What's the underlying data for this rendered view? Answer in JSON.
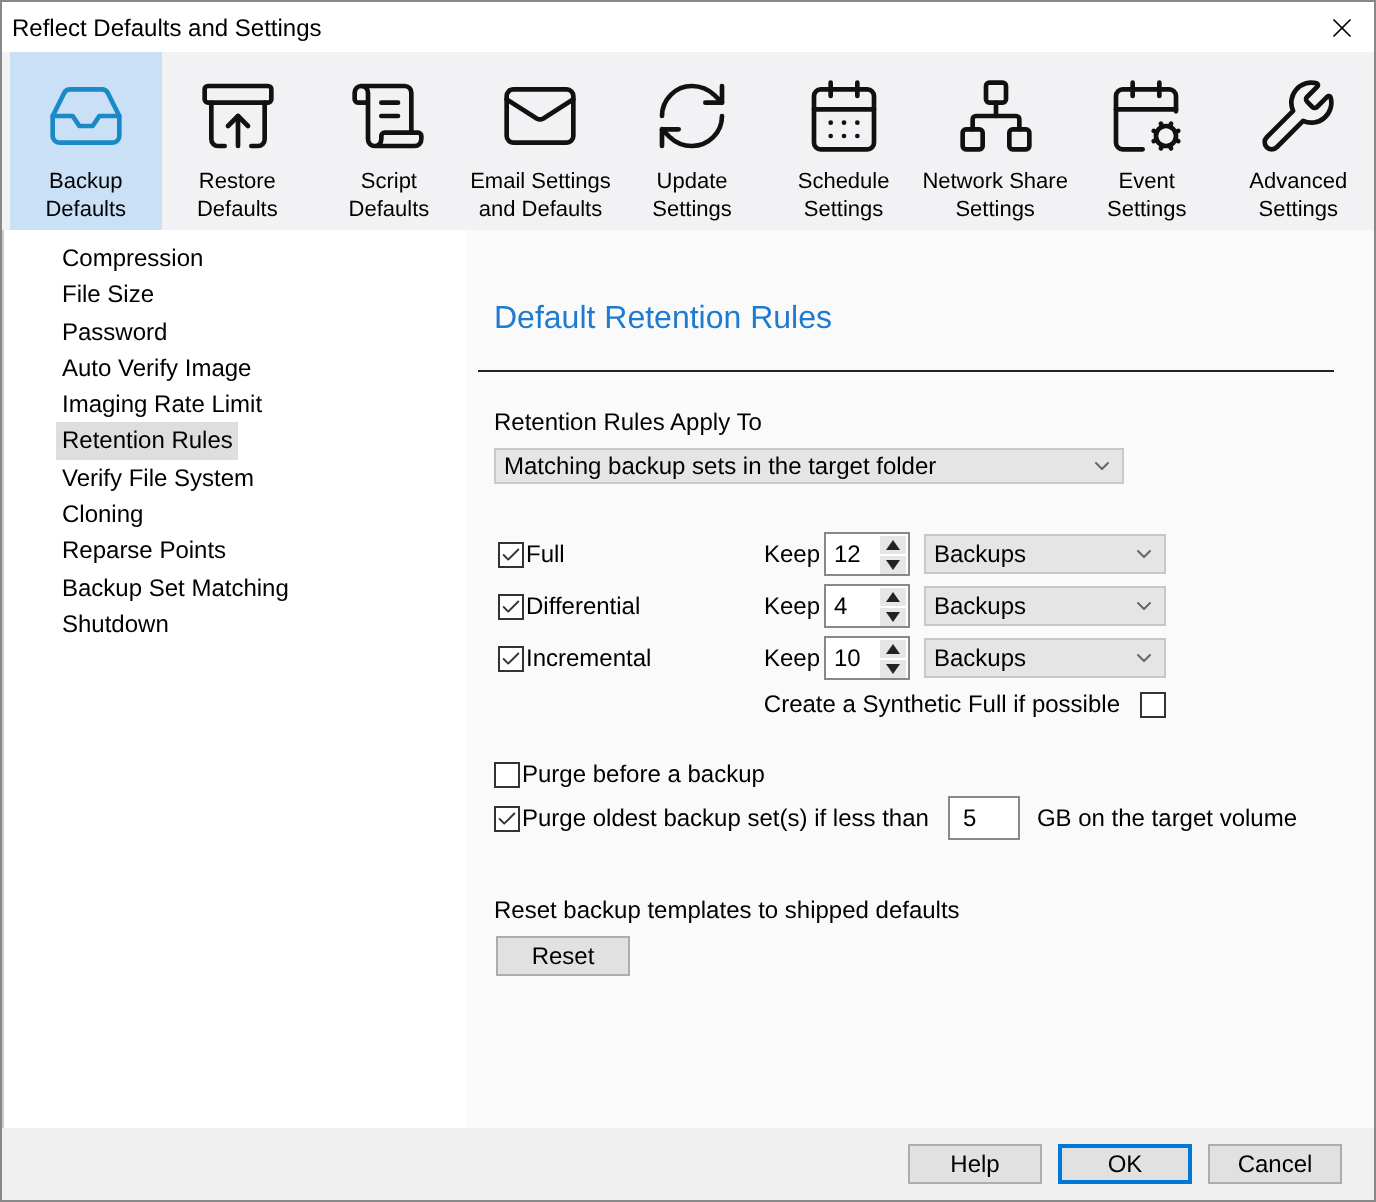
{
  "window": {
    "title": "Reflect Defaults and Settings"
  },
  "toolbar": [
    {
      "label": "Backup\nDefaults",
      "selected": true
    },
    {
      "label": "Restore\nDefaults",
      "selected": false
    },
    {
      "label": "Script\nDefaults",
      "selected": false
    },
    {
      "label": "Email Settings\nand Defaults",
      "selected": false
    },
    {
      "label": "Update\nSettings",
      "selected": false
    },
    {
      "label": "Schedule\nSettings",
      "selected": false
    },
    {
      "label": "Network Share\nSettings",
      "selected": false
    },
    {
      "label": "Event\nSettings",
      "selected": false
    },
    {
      "label": "Advanced\nSettings",
      "selected": false
    }
  ],
  "sidebar": {
    "items": [
      {
        "label": "Compression",
        "selected": false
      },
      {
        "label": "File Size",
        "selected": false
      },
      {
        "label": "Password",
        "selected": false
      },
      {
        "label": "Auto Verify Image",
        "selected": false
      },
      {
        "label": "Imaging Rate Limit",
        "selected": false
      },
      {
        "label": "Retention Rules",
        "selected": true
      },
      {
        "label": "Verify File System",
        "selected": false
      },
      {
        "label": "Cloning",
        "selected": false
      },
      {
        "label": "Reparse Points",
        "selected": false
      },
      {
        "label": "Backup Set Matching",
        "selected": false
      },
      {
        "label": "Shutdown",
        "selected": false
      }
    ]
  },
  "panel": {
    "heading": "Default Retention Rules",
    "apply_to": {
      "label": "Retention Rules Apply To",
      "value": "Matching backup sets in the target folder"
    },
    "rules": [
      {
        "label": "Full",
        "checked": true,
        "keep_label": "Keep",
        "count": "12",
        "unit": "Backups"
      },
      {
        "label": "Differential",
        "checked": true,
        "keep_label": "Keep",
        "count": "4",
        "unit": "Backups"
      },
      {
        "label": "Incremental",
        "checked": true,
        "keep_label": "Keep",
        "count": "10",
        "unit": "Backups"
      }
    ],
    "synthetic": {
      "label": "Create a Synthetic Full if possible",
      "checked": false
    },
    "purge": [
      {
        "kind": "plain",
        "label": "Purge before a backup",
        "checked": false
      },
      {
        "kind": "threshold",
        "label": "Purge oldest backup set(s) if less than",
        "checked": true,
        "value": "5",
        "suffix": "GB on the target volume"
      }
    ],
    "reset": {
      "label": "Reset backup templates to shipped defaults",
      "button": "Reset"
    }
  },
  "buttons": [
    {
      "label": "Help",
      "default": false
    },
    {
      "label": "OK",
      "default": true
    },
    {
      "label": "Cancel",
      "default": false
    }
  ]
}
